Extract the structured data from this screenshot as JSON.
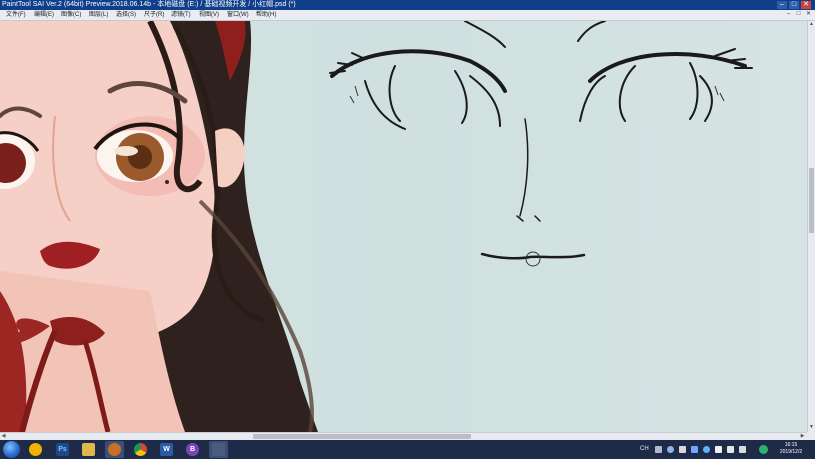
{
  "window": {
    "title": "PaintTool SAI Ver.2 (64bit) Preview.2018.06.14b - 本地磁盘 (E:) / 基础视频开发 / 小红帽.psd (*)",
    "controls": [
      "–",
      "□",
      "✕"
    ]
  },
  "menubar": {
    "items": [
      "文件(F)",
      "编辑(E)",
      "图像(C)",
      "图层(L)",
      "选择(S)",
      "尺子(R)",
      "滤镜(T)",
      "视图(V)",
      "窗口(W)",
      "帮助(H)"
    ],
    "right_controls": [
      "–",
      "□",
      "✕"
    ]
  },
  "scrollbars": {
    "arrow_up": "▲",
    "arrow_down": "▼",
    "arrow_left": "◀",
    "arrow_right": "▶"
  },
  "taskbar": {
    "apps": [
      {
        "name": "start-orb",
        "icon": "windows-orb-icon"
      },
      {
        "name": "app-yellow",
        "icon": "yellow-app-icon",
        "color": "#f0b400"
      },
      {
        "name": "app-photoshop",
        "icon": "photoshop-icon",
        "label": "Ps",
        "color": "#1b4a86"
      },
      {
        "name": "app-folder",
        "icon": "folder-icon",
        "color": "#e0b84a"
      },
      {
        "name": "app-paint",
        "icon": "paint-icon",
        "color": "#c86f2a"
      },
      {
        "name": "app-chrome",
        "icon": "chrome-icon",
        "color": "#2f9c4a"
      },
      {
        "name": "app-word",
        "icon": "word-icon",
        "label": "W",
        "color": "#2b5aa8"
      },
      {
        "name": "app-purple",
        "icon": "purple-app-icon",
        "label": "B",
        "color": "#7a45b8"
      },
      {
        "name": "app-sai",
        "icon": "sai-icon",
        "color": "#4b5d7a"
      }
    ],
    "tray_text": "CH",
    "time": "16:15",
    "date": "2019/12/2"
  }
}
